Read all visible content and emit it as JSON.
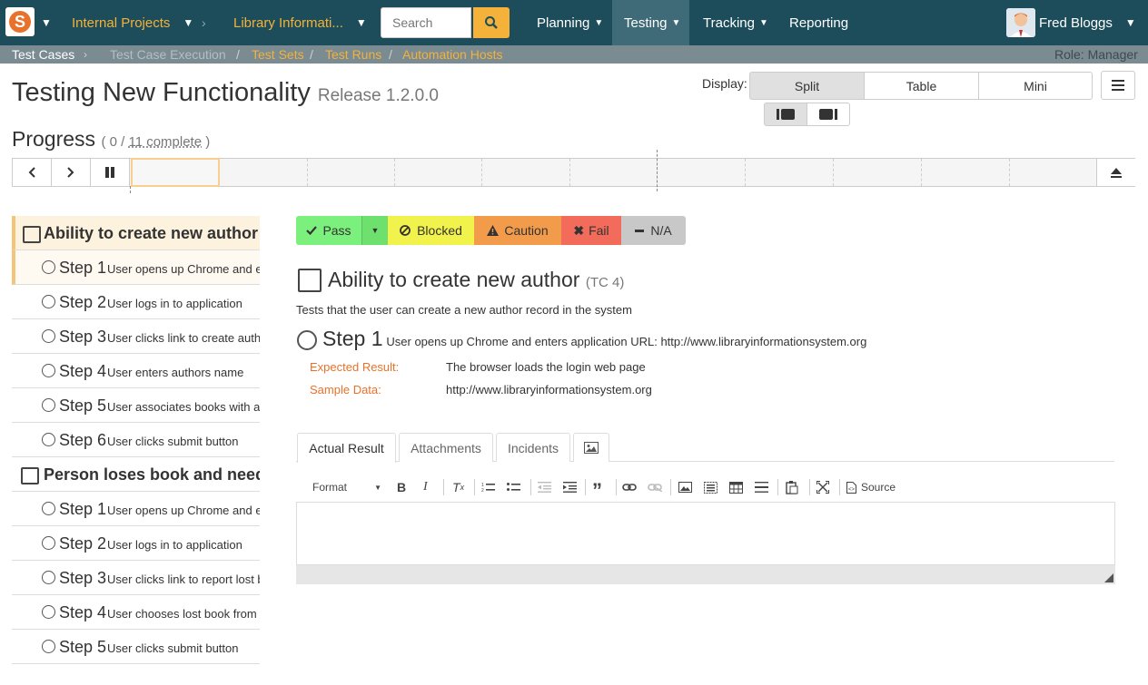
{
  "topnav": {
    "project": "Internal Projects",
    "product": "Library Informati...",
    "search_placeholder": "Search",
    "menus": [
      "Planning",
      "Testing",
      "Tracking",
      "Reporting"
    ],
    "user": "Fred Bloggs"
  },
  "subnav": {
    "items": [
      "Test Cases",
      "Test Case Execution",
      "Test Sets",
      "Test Runs",
      "Automation Hosts"
    ],
    "role": "Role: Manager"
  },
  "page": {
    "title": "Testing New Functionality",
    "release": "Release 1.2.0.0"
  },
  "display": {
    "label": "Display:",
    "options": [
      "Split",
      "Table",
      "Mini"
    ],
    "selected": "Split"
  },
  "progress": {
    "label": "Progress",
    "done": "0",
    "total": "11 complete",
    "segments": 11
  },
  "sidebar": {
    "cases": [
      {
        "title": "Ability to create new author",
        "steps": [
          {
            "num": "Step 1",
            "text": "User opens up Chrome and enters application URL"
          },
          {
            "num": "Step 2",
            "text": "User logs in to application"
          },
          {
            "num": "Step 3",
            "text": "User clicks link to create author"
          },
          {
            "num": "Step 4",
            "text": "User enters authors name"
          },
          {
            "num": "Step 5",
            "text": "User associates books with author"
          },
          {
            "num": "Step 6",
            "text": "User clicks submit button"
          }
        ]
      },
      {
        "title": "Person loses book and needs to report",
        "steps": [
          {
            "num": "Step 1",
            "text": "User opens up Chrome and enters application URL"
          },
          {
            "num": "Step 2",
            "text": "User logs in to application"
          },
          {
            "num": "Step 3",
            "text": "User clicks link to report lost book"
          },
          {
            "num": "Step 4",
            "text": "User chooses lost book from list"
          },
          {
            "num": "Step 5",
            "text": "User clicks submit button"
          }
        ]
      }
    ]
  },
  "actions": {
    "pass": "Pass",
    "blocked": "Blocked",
    "caution": "Caution",
    "fail": "Fail",
    "na": "N/A"
  },
  "detail": {
    "tc_title": "Ability to create new author",
    "tc_id": "(TC 4)",
    "description": "Tests that the user can create a new author record in the system",
    "step_num": "Step 1",
    "step_text": "User opens up Chrome and enters application URL: http://www.libraryinformationsystem.org",
    "expected_label": "Expected Result:",
    "expected_value": "The browser loads the login web page",
    "sample_label": "Sample Data:",
    "sample_value": "http://www.libraryinformationsystem.org"
  },
  "tabs": [
    "Actual Result",
    "Attachments",
    "Incidents"
  ],
  "editor": {
    "format": "Format",
    "source": "Source"
  },
  "colors": {
    "nav": "#1d4d5b",
    "accent": "#f4b23a",
    "pass": "#7cf07c",
    "blocked": "#f2f24d",
    "caution": "#f29b4b",
    "fail": "#f26b5b",
    "na": "#c8c8c8",
    "expected_label": "#e8722b"
  }
}
